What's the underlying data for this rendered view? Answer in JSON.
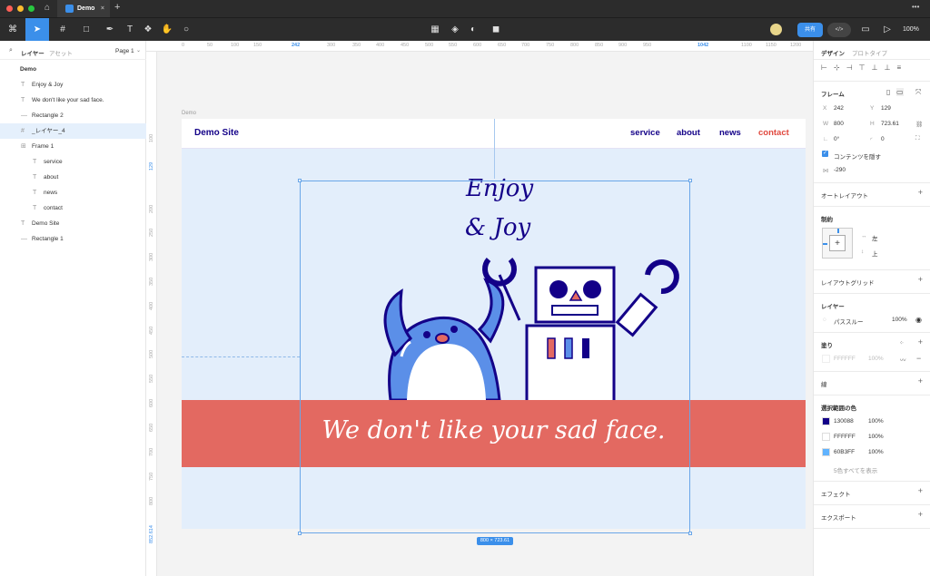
{
  "window": {
    "tab_title": "Demo",
    "new_tab": "+",
    "menu": "•••"
  },
  "toolbar": {
    "share_label": "共有",
    "zoom": "100%"
  },
  "left_panel": {
    "tabs": [
      "レイヤー",
      "アセット"
    ],
    "page": "Page 1",
    "root": "Demo",
    "layers": [
      {
        "name": "Enjoy & Joy",
        "icon": "T",
        "indent": 1
      },
      {
        "name": "We don't like your sad face.",
        "icon": "T",
        "indent": 1
      },
      {
        "name": "Rectangle 2",
        "icon": "—",
        "indent": 1
      },
      {
        "name": "_レイヤー_4",
        "icon": "#",
        "indent": 1
      },
      {
        "name": "Frame 1",
        "icon": "⊞",
        "indent": 1
      },
      {
        "name": "service",
        "icon": "T",
        "indent": 2
      },
      {
        "name": "about",
        "icon": "T",
        "indent": 2
      },
      {
        "name": "news",
        "icon": "T",
        "indent": 2
      },
      {
        "name": "contact",
        "icon": "T",
        "indent": 2
      },
      {
        "name": "Demo Site",
        "icon": "T",
        "indent": 1
      },
      {
        "name": "Rectangle 1",
        "icon": "—",
        "indent": 1
      }
    ]
  },
  "ruler": {
    "top": [
      "0",
      "50",
      "100",
      "150",
      "242",
      "300",
      "350",
      "400",
      "450",
      "500",
      "550",
      "600",
      "650",
      "700",
      "750",
      "800",
      "850",
      "900",
      "950",
      "1042",
      "1100",
      "1150",
      "1200",
      "1250"
    ],
    "left": [
      "100",
      "129",
      "200",
      "250",
      "300",
      "350",
      "400",
      "450",
      "500",
      "550",
      "600",
      "650",
      "700",
      "750",
      "800",
      "852.614"
    ]
  },
  "canvas": {
    "frame_label": "Demo",
    "brand": "Demo Site",
    "nav": [
      "service",
      "about",
      "news",
      "contact"
    ],
    "headline_1": "Enjoy",
    "headline_2": "& Joy",
    "banner_text": "We don't like your sad face.",
    "selection_size": "800 × 723.61"
  },
  "right_panel": {
    "tabs": [
      "デザイン",
      "プロトタイプ"
    ],
    "frame_title": "フレーム",
    "x_label": "X",
    "x": "242",
    "y_label": "Y",
    "y": "129",
    "w_label": "W",
    "w": "800",
    "h_label": "H",
    "h": "723.61",
    "rotation": "0°",
    "radius": "0",
    "clip_label": "コンテンツを隠す",
    "spacing": "-290",
    "auto_layout": "オートレイアウト",
    "constraints": "制約",
    "constraint_h": "左",
    "constraint_v": "上",
    "layout_grid": "レイアウトグリッド",
    "layer_title": "レイヤー",
    "blend_mode": "パススルー",
    "opacity": "100%",
    "fill_title": "塗り",
    "fill_hex": "FFFFFF",
    "fill_opacity": "100%",
    "stroke_title": "線",
    "selection_colors_title": "選択範囲の色",
    "selection_colors": [
      {
        "hex": "130088",
        "opacity": "100%",
        "color": "#130088"
      },
      {
        "hex": "FFFFFF",
        "opacity": "100%",
        "color": "#FFFFFF"
      },
      {
        "hex": "60B3FF",
        "opacity": "100%",
        "color": "#60B3FF"
      }
    ],
    "show_all_colors": "5色すべてを表示",
    "effects": "エフェクト",
    "export": "エクスポート"
  },
  "colors": {
    "accent": "#3b8fea",
    "navy": "#130088",
    "banner": "#e36961",
    "contact": "#e0483e"
  }
}
